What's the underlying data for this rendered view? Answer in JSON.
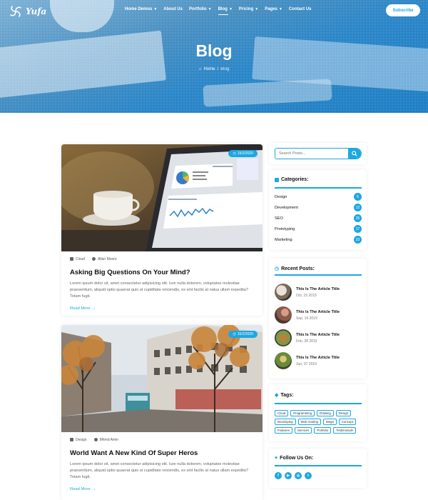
{
  "header": {
    "brand": "Yufa",
    "nav": [
      {
        "label": "Home Demos",
        "has_menu": true
      },
      {
        "label": "About Us",
        "has_menu": false
      },
      {
        "label": "Portfolio",
        "has_menu": true
      },
      {
        "label": "Blog",
        "has_menu": true,
        "active": true
      },
      {
        "label": "Pricing",
        "has_menu": true
      },
      {
        "label": "Pages",
        "has_menu": true
      },
      {
        "label": "Contact Us",
        "has_menu": false
      }
    ],
    "subscribe_label": "Subscribe"
  },
  "hero": {
    "title": "Blog",
    "breadcrumb_home": "Home",
    "breadcrumb_sep": "/",
    "breadcrumb_current": "Blog"
  },
  "posts": [
    {
      "date": "15/2/2020",
      "category": "Cloud",
      "author": "Allan Moore",
      "title": "Asking Big Questions On Your Mind?",
      "excerpt": "Lorem ipsum dolor sit, amet consectetur adipisicing elit. Iure nulla dolorem, voluptates molestiae praesentium, aliquid optio quaerat quis ut cupiditate reiciendis, ex sint facilis at natus ullam expedita? Totam fugit.",
      "read_more": "Read More"
    },
    {
      "date": "15/2/2020",
      "category": "Design",
      "author": "Mhmd Amin",
      "title": "World Want A New Kind Of Super Heros",
      "excerpt": "Lorem ipsum dolor sit, amet consectetur adipisicing elit. Iure nulla dolorem, voluptates molestiae praesentium, aliquid optio quaerat quis ut cupiditate reiciendis, ex sint facilis at natus ullam expedita? Totam fugit.",
      "read_more": "Read More"
    }
  ],
  "sidebar": {
    "search_placeholder": "Search Posts...",
    "categories_title": "Categories:",
    "categories": [
      {
        "name": "Design",
        "count": "5"
      },
      {
        "name": "Development",
        "count": "12"
      },
      {
        "name": "SEO",
        "count": "35"
      },
      {
        "name": "Prototyping",
        "count": "17"
      },
      {
        "name": "Marketing",
        "count": "33"
      }
    ],
    "recent_title": "Recent Posts:",
    "recent": [
      {
        "title": "This Is The Article Title",
        "date": "Oct, 15 2019"
      },
      {
        "title": "This Is The Article Title",
        "date": "Sep, 10 2019"
      },
      {
        "title": "This Is The Article Title",
        "date": "Feb, 28 2019"
      },
      {
        "title": "This Is The Article Title",
        "date": "Jun, 07 2019"
      }
    ],
    "tags_title": "Tags:",
    "tags": [
      "Cloud",
      "Programming",
      "Drawing",
      "Design",
      "Developing",
      "Web Hosting",
      "Mega",
      "Concept",
      "Features",
      "Services",
      "Portfolio",
      "Testimonials"
    ],
    "follow_title": "Follow Us On:",
    "social": [
      {
        "icon": "facebook-icon",
        "glyph": "f"
      },
      {
        "icon": "youtube-icon",
        "glyph": "▶"
      },
      {
        "icon": "instagram-icon",
        "glyph": "◎"
      },
      {
        "icon": "twitter-icon",
        "glyph": "t"
      }
    ]
  },
  "colors": {
    "accent": "#1ea7e1",
    "hero": "#2b86c8"
  }
}
